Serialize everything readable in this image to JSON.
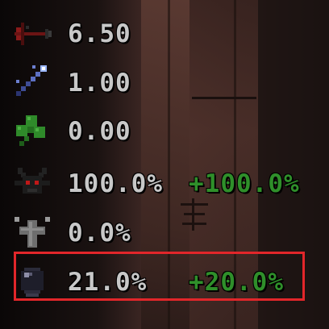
{
  "stats": [
    {
      "icon": "arrow-range-icon",
      "value": "6.50",
      "bonus": ""
    },
    {
      "icon": "wand-shot-speed-icon",
      "value": "1.00",
      "bonus": ""
    },
    {
      "icon": "clover-luck-icon",
      "value": "0.00",
      "bonus": ""
    },
    {
      "icon": "devil-head-icon",
      "value": "100.0%",
      "bonus": "+100.0%"
    },
    {
      "icon": "angel-cross-icon",
      "value": "0.0%",
      "bonus": ""
    },
    {
      "icon": "dark-orb-icon",
      "value": "21.0%",
      "bonus": "+20.0%"
    }
  ],
  "colors": {
    "stat_text": "#c8c8c8",
    "bonus_text": "#2f8f2a",
    "highlight_border": "#e2262a"
  },
  "highlighted_row": 5
}
